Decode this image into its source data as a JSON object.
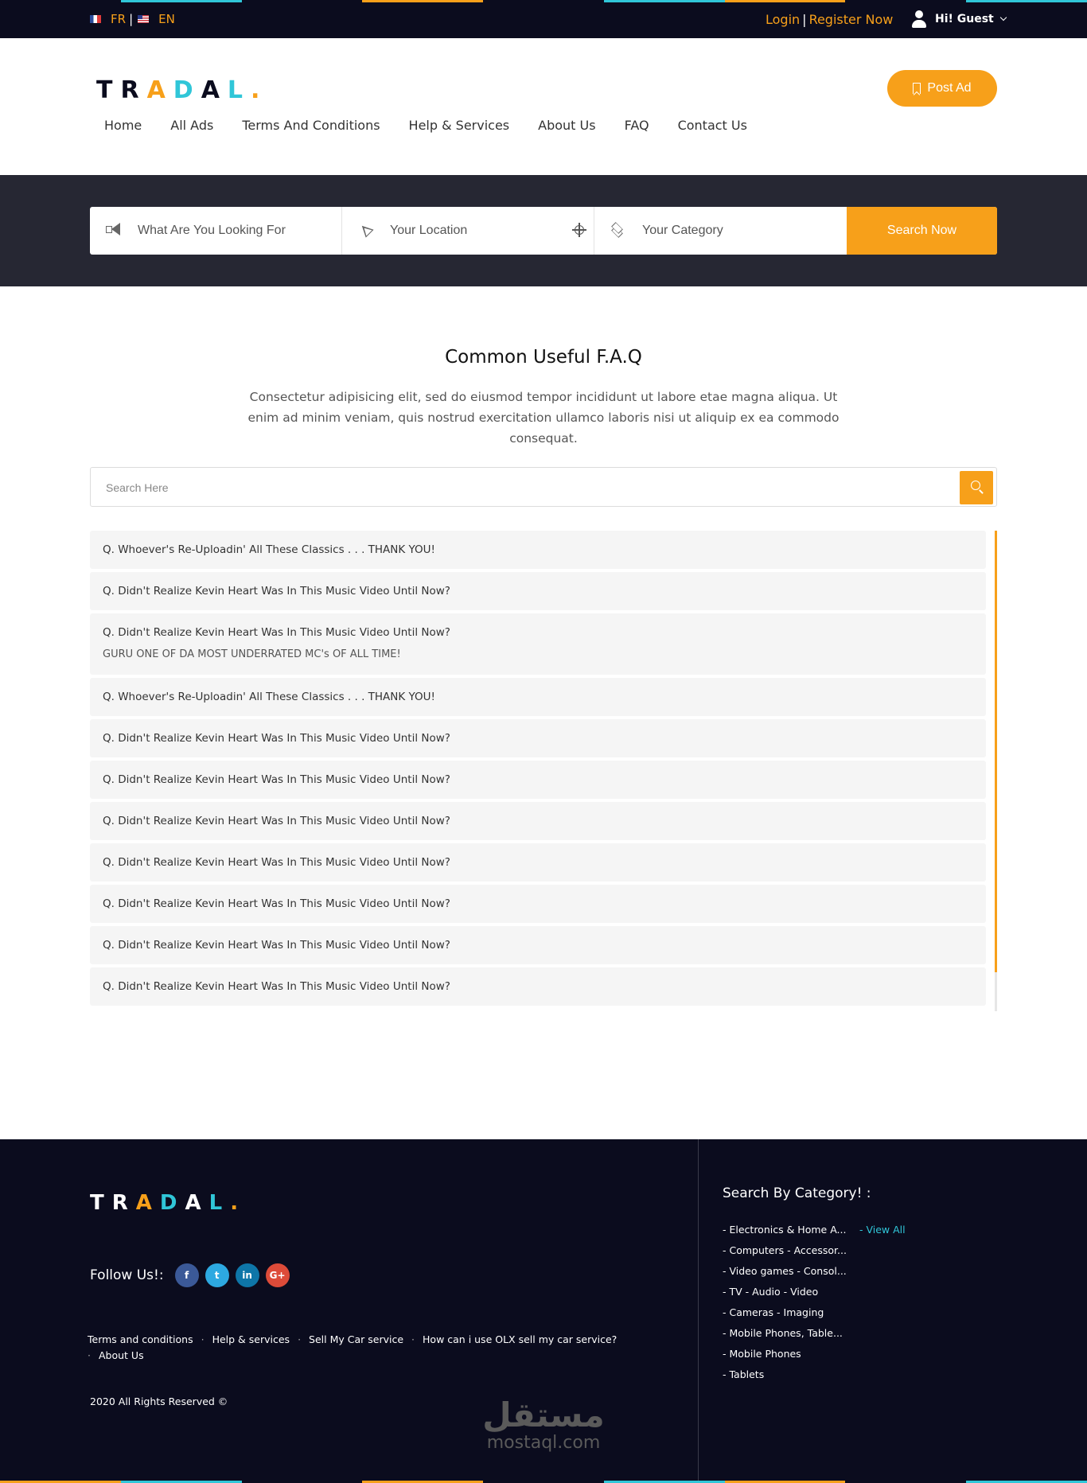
{
  "topbar": {
    "lang_fr": "FR",
    "lang_en": "EN",
    "login": "Login",
    "register": "Register Now",
    "guest": "Hi! Guest"
  },
  "brand": {
    "logo": [
      "T",
      "R",
      "A",
      "D",
      "A",
      "L",
      "."
    ],
    "logo_colors": [
      "#0b0c1e",
      "#0b0c1e",
      "#f7a01a",
      "#30c6d8",
      "#0b0c1e",
      "#30c6d8",
      "#f7a01a"
    ],
    "logo_colors_footer": [
      "#ffffff",
      "#ffffff",
      "#f7a01a",
      "#30c6d8",
      "#ffffff",
      "#30c6d8",
      "#f7a01a"
    ]
  },
  "header": {
    "post_ad": "Post Ad",
    "nav": [
      "Home",
      "All Ads",
      "Terms And Conditions",
      "Help & Services",
      "About Us",
      "FAQ",
      "Contact Us"
    ]
  },
  "search": {
    "what_placeholder": "What Are You Looking For",
    "location_placeholder": "Your Location",
    "category_placeholder": "Your Category",
    "button": "Search Now"
  },
  "faq": {
    "title": "Common Useful F.A.Q",
    "description": "Consectetur adipisicing elit, sed do eiusmod tempor incididunt ut labore etae magna aliqua. Ut enim ad minim veniam, quis nostrud exercitation ullamco laboris nisi ut aliquip ex ea commodo consequat.",
    "search_placeholder": "Search Here",
    "items": [
      {
        "q": "Q. Whoever's Re-Uploadin' All These Classics . . . THANK YOU!",
        "a": ""
      },
      {
        "q": "Q. Didn't Realize Kevin Heart Was In This Music Video Until Now?",
        "a": ""
      },
      {
        "q": "Q. Didn't Realize Kevin Heart Was In This Music Video Until Now?",
        "a": "GURU ONE OF DA MOST UNDERRATED MC's OF ALL TIME!"
      },
      {
        "q": "Q. Whoever's Re-Uploadin' All These Classics . . . THANK YOU!",
        "a": ""
      },
      {
        "q": "Q. Didn't Realize Kevin Heart Was In This Music Video Until Now?",
        "a": ""
      },
      {
        "q": "Q. Didn't Realize Kevin Heart Was In This Music Video Until Now?",
        "a": ""
      },
      {
        "q": "Q. Didn't Realize Kevin Heart Was In This Music Video Until Now?",
        "a": ""
      },
      {
        "q": "Q. Didn't Realize Kevin Heart Was In This Music Video Until Now?",
        "a": ""
      },
      {
        "q": "Q. Didn't Realize Kevin Heart Was In This Music Video Until Now?",
        "a": ""
      },
      {
        "q": "Q. Didn't Realize Kevin Heart Was In This Music Video Until Now?",
        "a": ""
      },
      {
        "q": "Q. Didn't Realize Kevin Heart Was In This Music Video Until Now?",
        "a": ""
      }
    ]
  },
  "footer": {
    "follow": "Follow Us!:",
    "social": [
      {
        "icon": "facebook-icon",
        "glyph": "f",
        "color": "#3b5998"
      },
      {
        "icon": "twitter-icon",
        "glyph": "t",
        "color": "#2da9e1"
      },
      {
        "icon": "linkedin-icon",
        "glyph": "in",
        "color": "#0e76a8"
      },
      {
        "icon": "google-plus-icon",
        "glyph": "G+",
        "color": "#dd4b39"
      }
    ],
    "links": [
      "Terms and conditions",
      "Help & services",
      "Sell My Car service",
      "How can i use OLX sell my car service?",
      "About Us"
    ],
    "copyright": "2020 All Rights Reserved ©",
    "category_title": "Search By Category! :",
    "categories": [
      "- Electronics & Home A...",
      "- Computers - Accessor...",
      "- Video games - Consol...",
      "- TV - Audio - Video",
      "- Cameras - Imaging",
      "- Mobile Phones, Table...",
      "- Mobile Phones",
      "- Tablets"
    ],
    "view_all": "- View All"
  },
  "watermark": {
    "arabic": "مستقل",
    "latin": "mostaql.com"
  },
  "colors": {
    "accent": "#f7a01a",
    "teal": "#30c6d8",
    "dark": "#0b0c1e",
    "band": "#262733"
  }
}
